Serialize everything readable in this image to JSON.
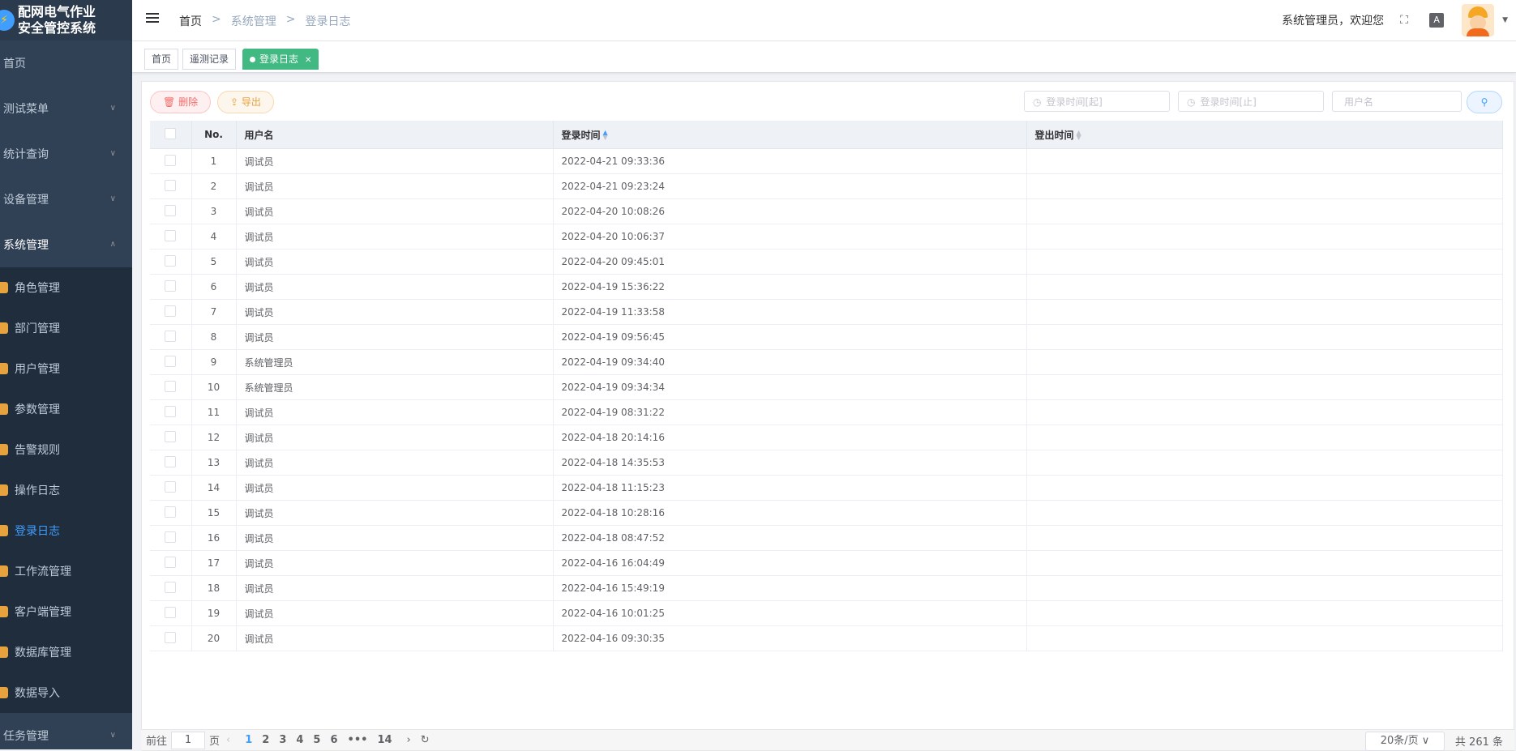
{
  "app": {
    "title_line1": "配网电气作业",
    "title_line2": "安全管控系统"
  },
  "sidebar": {
    "top_items": [
      {
        "label": "首页"
      },
      {
        "label": "测试菜单"
      },
      {
        "label": "统计查询"
      },
      {
        "label": "设备管理"
      },
      {
        "label": "系统管理"
      }
    ],
    "sub_items": [
      {
        "label": "角色管理"
      },
      {
        "label": "部门管理"
      },
      {
        "label": "用户管理"
      },
      {
        "label": "参数管理"
      },
      {
        "label": "告警规则"
      },
      {
        "label": "操作日志"
      },
      {
        "label": "登录日志"
      },
      {
        "label": "工作流管理"
      },
      {
        "label": "客户端管理"
      },
      {
        "label": "数据库管理"
      },
      {
        "label": "数据导入"
      }
    ],
    "bottom_item": {
      "label": "任务管理"
    }
  },
  "header": {
    "breadcrumb": [
      "首页",
      "系统管理",
      "登录日志"
    ],
    "welcome": "系统管理员，欢迎您"
  },
  "tabs": [
    {
      "label": "首页"
    },
    {
      "label": "遥测记录"
    },
    {
      "label": "登录日志"
    }
  ],
  "toolbar": {
    "delete_label": "删除",
    "export_label": "导出",
    "login_start_placeholder": "登录时间[起]",
    "login_end_placeholder": "登录时间[止]",
    "username_placeholder": "用户名"
  },
  "table": {
    "columns": [
      "No.",
      "用户名",
      "登录时间",
      "登出时间"
    ],
    "rows": [
      {
        "no": "1",
        "user": "调试员",
        "login": "2022-04-21 09:33:36",
        "logout": ""
      },
      {
        "no": "2",
        "user": "调试员",
        "login": "2022-04-21 09:23:24",
        "logout": ""
      },
      {
        "no": "3",
        "user": "调试员",
        "login": "2022-04-20 10:08:26",
        "logout": ""
      },
      {
        "no": "4",
        "user": "调试员",
        "login": "2022-04-20 10:06:37",
        "logout": ""
      },
      {
        "no": "5",
        "user": "调试员",
        "login": "2022-04-20 09:45:01",
        "logout": ""
      },
      {
        "no": "6",
        "user": "调试员",
        "login": "2022-04-19 15:36:22",
        "logout": ""
      },
      {
        "no": "7",
        "user": "调试员",
        "login": "2022-04-19 11:33:58",
        "logout": ""
      },
      {
        "no": "8",
        "user": "调试员",
        "login": "2022-04-19 09:56:45",
        "logout": ""
      },
      {
        "no": "9",
        "user": "系统管理员",
        "login": "2022-04-19 09:34:40",
        "logout": ""
      },
      {
        "no": "10",
        "user": "系统管理员",
        "login": "2022-04-19 09:34:34",
        "logout": ""
      },
      {
        "no": "11",
        "user": "调试员",
        "login": "2022-04-19 08:31:22",
        "logout": ""
      },
      {
        "no": "12",
        "user": "调试员",
        "login": "2022-04-18 20:14:16",
        "logout": ""
      },
      {
        "no": "13",
        "user": "调试员",
        "login": "2022-04-18 14:35:53",
        "logout": ""
      },
      {
        "no": "14",
        "user": "调试员",
        "login": "2022-04-18 11:15:23",
        "logout": ""
      },
      {
        "no": "15",
        "user": "调试员",
        "login": "2022-04-18 10:28:16",
        "logout": ""
      },
      {
        "no": "16",
        "user": "调试员",
        "login": "2022-04-18 08:47:52",
        "logout": ""
      },
      {
        "no": "17",
        "user": "调试员",
        "login": "2022-04-16 16:04:49",
        "logout": ""
      },
      {
        "no": "18",
        "user": "调试员",
        "login": "2022-04-16 15:49:19",
        "logout": ""
      },
      {
        "no": "19",
        "user": "调试员",
        "login": "2022-04-16 10:01:25",
        "logout": ""
      },
      {
        "no": "20",
        "user": "调试员",
        "login": "2022-04-16 09:30:35",
        "logout": ""
      }
    ]
  },
  "pagination": {
    "goto_prefix": "前往",
    "goto_value": "1",
    "goto_suffix": "页",
    "pages": [
      "1",
      "2",
      "3",
      "4",
      "5",
      "6",
      "•••",
      "14"
    ],
    "page_size": "20条/页",
    "total": "共 261 条"
  }
}
